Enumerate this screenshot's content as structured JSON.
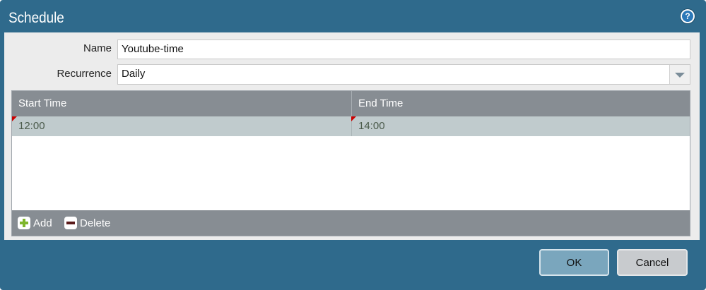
{
  "dialog": {
    "title": "Schedule",
    "help_icon": "help-icon",
    "help_glyph": "?"
  },
  "form": {
    "name_label": "Name",
    "name_value": "Youtube-time",
    "recurrence_label": "Recurrence",
    "recurrence_value": "Daily"
  },
  "grid": {
    "columns": [
      "Start Time",
      "End Time"
    ],
    "rows": [
      {
        "start": "12:00",
        "end": "14:00"
      }
    ],
    "footer": {
      "add_label": "Add",
      "delete_label": "Delete"
    }
  },
  "buttons": {
    "ok_label": "OK",
    "cancel_label": "Cancel"
  },
  "colors": {
    "titlebar": "#2f6a8c",
    "grid_header": "#878d93",
    "selected_row": "#c0cbcd",
    "add_icon": "#7fb62c",
    "ok_button": "#7aa6bd"
  }
}
